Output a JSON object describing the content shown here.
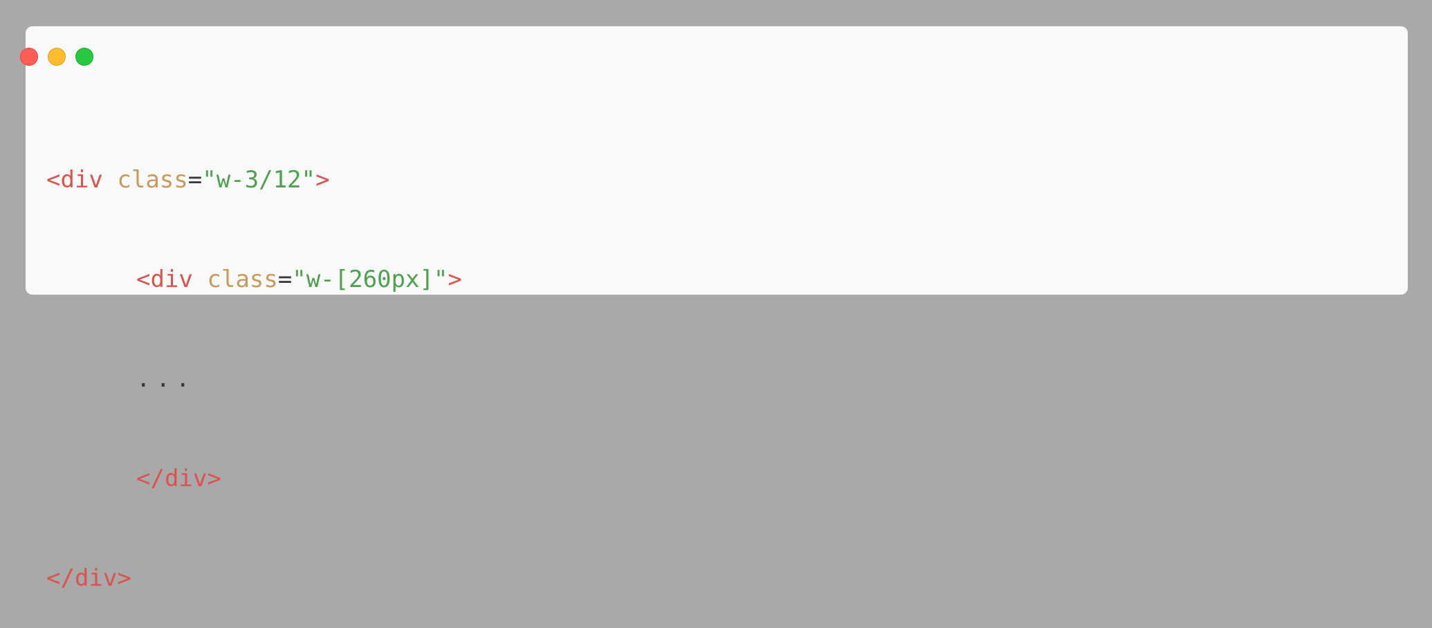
{
  "window": {
    "controls": {
      "close": "close-dot",
      "minimize": "minimize-dot",
      "maximize": "maximize-dot",
      "colors": {
        "close": "#ff5f57",
        "minimize": "#febc2e",
        "maximize": "#28c840"
      }
    }
  },
  "code": {
    "line1": {
      "open": "<div",
      "attr": "class",
      "eq": "=",
      "value": "\"w-3/12\"",
      "close": ">"
    },
    "line2": {
      "open": "<div",
      "attr": "class",
      "eq": "=",
      "value": "\"w-[260px]\"",
      "close": ">"
    },
    "line3": {
      "text": "..."
    },
    "line4": {
      "text": "</div>"
    },
    "line5": {
      "text": "</div>"
    }
  },
  "colors": {
    "background": "#a9a9a9",
    "panel": "#f9f9f9",
    "tag": "#d9534f",
    "attribute": "#c99a5e",
    "string": "#50a14f",
    "text": "#383a42"
  }
}
